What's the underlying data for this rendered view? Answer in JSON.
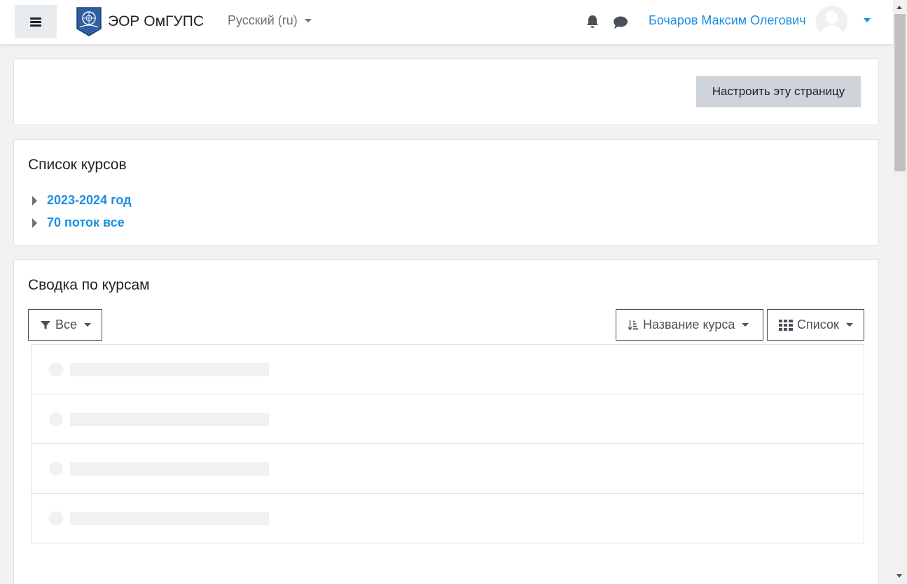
{
  "navbar": {
    "menu_icon": "hamburger-icon",
    "brand": "ЭОР ОмГУПС",
    "language": "Русский ‎(ru)‎",
    "notifications_icon": "bell-icon",
    "messages_icon": "chat-icon",
    "user_name": "Бочаров Максим Олегович",
    "avatar_icon": "user-avatar-icon"
  },
  "page": {
    "edit_button": "Настроить эту страницу"
  },
  "course_list": {
    "title": "Список курсов",
    "categories": [
      {
        "label": "2023-2024 год"
      },
      {
        "label": "70 поток все"
      }
    ]
  },
  "course_overview": {
    "title": "Сводка по курсам",
    "filter_label": "Все",
    "sort_label": "Название курса",
    "view_label": "Список",
    "placeholder_rows": 4
  },
  "colors": {
    "link": "#1a8fe3",
    "button_bg": "#ced4da",
    "page_bg": "#f2f2f2"
  }
}
